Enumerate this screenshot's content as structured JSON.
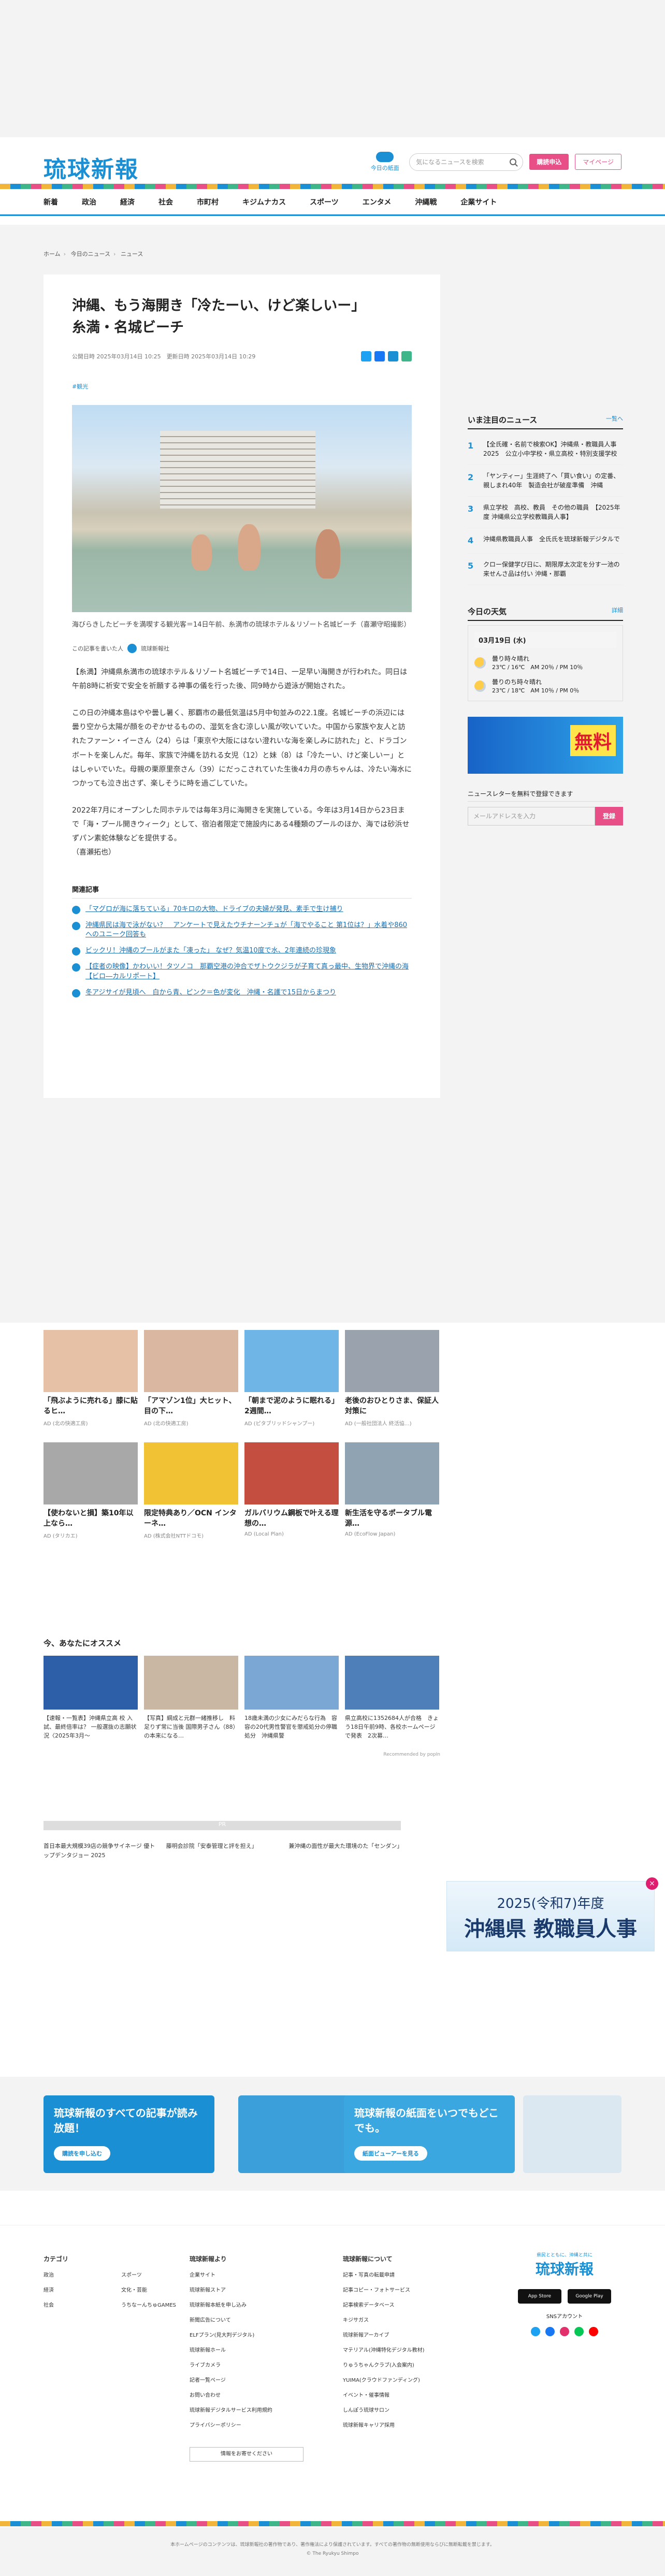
{
  "header": {
    "logo": "琉球新報",
    "today_label": "今日の紙面",
    "search_placeholder": "気になるニュースを検索",
    "subscribe": "購読申込",
    "mypage": "マイページ"
  },
  "nav": [
    "新着",
    "政治",
    "経済",
    "社会",
    "市町村",
    "キジムナカス",
    "スポーツ",
    "エンタメ",
    "沖縄戦",
    "企業サイト"
  ],
  "breadcrumb": [
    "ホーム",
    "今日のニュース",
    "ニュース"
  ],
  "article": {
    "title": "沖縄、もう海開き「冷たーい、けど楽しいー」 糸満・名城ビーチ",
    "published": "公開日時 2025年03月14日 10:25",
    "updated": "更新日時 2025年03月14日 10:29",
    "tag": "#観光",
    "caption": "海びらきしたビーチを満喫する観光客＝14日午前、糸満市の琉球ホテル＆リゾート名城ビーチ（喜瀬守昭撮影）",
    "writer_prefix": "この記事を書いた人",
    "writer": "琉球新報社",
    "paragraphs": [
      "【糸満】沖縄県糸満市の琉球ホテル＆リゾート名城ビーチで14日、一足早い海開きが行われた。同日は午前8時に祈安で安全を祈願する神事の儀を行った後、同9時から遊泳が開始された。",
      "この日の沖縄本島はやや曇し暑く、那覇市の最低気温は5月中旬並みの22.1度。名城ビーチの浜辺には曇り空から太陽が顔をのぞかせるものの、湿気を含む涼しい風が吹いていた。中国から家族や友人と訪れたファーン・イーさん（24）らは「東京や大阪にはない澄れいな海を楽しみに訪れた」と、ドラゴンボートを楽しんだ。毎年、家族で沖縄を訪れる女児（12）と妹（8）は「冷たーい、けど楽しいー」とはしゃいでいた。母親の栗原里奈さん（39）にだっこされていた生後4カ月の赤ちゃんは、冷たい海水につかっても泣き出さず、楽しそうに時を過ごしていた。",
      "2022年7月にオープンした同ホテルでは毎年3月に海開きを実施している。今年は3月14日から23日まで「海・プール開きウィーク」として、宿泊者限定で施設内にある4種類のプールのほか、海では砂浜せずパン素蛇体験などを提供する。",
      "（喜瀬拓也）"
    ],
    "related_heading": "関連記事",
    "related": [
      "「マグロが海に落ちている」70キロの大物、ドライブの夫婦が発見、素手で生け捕り",
      "沖縄県民は海で泳がない？　アンケートで見えたウチナーンチュが「海でやること 第1位は？」水着や860へのユニーク回答も",
      "ビックリ！沖縄のプールがまた「凍った」 なぜ？気温10度で水、2年連続の珍現象",
      "【症者の映像】かわいい！タツノコ　那覇空港の沖合でザトウクジラが子育て真っ最中、生物界で沖縄の海【ビロ―カルリポート】",
      "冬アジサイが見頃へ　白から青、ピンク＝色が変化　沖縄・名護で15日からまつり"
    ]
  },
  "sidebar": {
    "ranking_title": "いま注目のニュース",
    "ranking_more": "一覧へ",
    "ranking": [
      "【全氏確・名前で検索OK】沖縄県・教職員人事2025　公立小中学校・県立高校・特別支援学校",
      "「ヤンティー」生涯終了へ「買い食い」の定番、親しまれ40年　製造会社が破産準備　沖縄",
      "県立学校　高校、教員　その他の職員　【2025年度 沖縄県公立学校教職員人事】",
      "沖縄県教職員人事　全氏氏を琉球新報デジタルで",
      "クロー保健学び日に、期限厚太次定を分す一池の来せんさ品は付い 沖縄・那覇"
    ],
    "weather_title": "今日の天気",
    "weather_more": "詳細",
    "weather_date": "03月19日 (水)",
    "weather_rows": [
      {
        "label": "曇り時々晴れ",
        "detail": "23℃ / 16℃　AM 20％ / PM 10％"
      },
      {
        "label": "曇りのち時々晴れ",
        "detail": "23℃ / 18℃　AM 10％ / PM 0％"
      }
    ],
    "ad_text": "無料",
    "newsletter_title": "ニュースレターを無料で登録できます",
    "newsletter_placeholder": "メールアドレスを入力",
    "newsletter_button": "登録"
  },
  "ads": [
    {
      "title": "「飛ぶように売れる」膝に貼るヒ…",
      "src": "AD (北の快適工房)"
    },
    {
      "title": "「アマゾン1位」大ヒット、目の下…",
      "src": "AD (北の快適工房)"
    },
    {
      "title": "「朝まで泥のように眠れる」2週間…",
      "src": "AD (ピタブリッドシャンプー)"
    },
    {
      "title": "老後のおひとりさま、保証人対策に",
      "src": "AD (一般社団法人 終活協…)"
    },
    {
      "title": "【使わないと損】築10年以上なら…",
      "src": "AD (タリカエ)"
    },
    {
      "title": "限定特典あり／OCN インターネ…",
      "src": "AD (株式会社NTTドコモ)"
    },
    {
      "title": "ガルバリウム鋼板で叶える理想の…",
      "src": "AD (Local Plan)"
    },
    {
      "title": "新生活を守るポータブル電源…",
      "src": "AD (EcoFlow Japan)"
    }
  ],
  "reco": {
    "title": "今、あなたにオススメ",
    "items": [
      "【速報・一覧表】沖縄県立高 校 入試、最終倍率は？ 一般選抜の志願状況〈2025年3月〜",
      "【写真】綱成と元群一緒推移し　料足りず常に当後 国際男子さん（88）の本来になる…",
      "18歳未満の少女にみだらな行為　容容の20代男性警官を懲戒処分の停職処分　沖縄県警",
      "県立高校に1352684人が合格　きょう18日午前9時、各校ホームページで発表　2次募…"
    ],
    "powered": "Recommended by popIn"
  },
  "ticker": {
    "label": "PR",
    "items": [
      "首日本最大規模39店の競争サイネージ 優トップデンタジョー 2025",
      "藤明会診院「安泰管理と評を担え」",
      "兼沖縄の面性が最大た環境のた「センダン」"
    ]
  },
  "banner": {
    "year": "2025(令和7)年度",
    "main": "沖縄県 教職員人事"
  },
  "promo": {
    "card1_heading": "琉球新報のすべての記事が読み放題！",
    "card1_button": "購読を申し込む",
    "card2_heading": "琉球新報の紙面をいつでもどこでも。",
    "card2_button": "紙面ビューアーを見る"
  },
  "footer": {
    "col1_title": "カテゴリ",
    "col1": [
      "政治",
      "経済",
      "社会",
      "スポーツ",
      "文化・芸能",
      "うちなーんちゅGAMES"
    ],
    "col2_title": "琉球新報より",
    "col2": [
      "企業サイト",
      "琉球新報ストア",
      "琉球新報本紙を申し込み",
      "新聞広告について",
      "ELFプラン(見大判デジタル)",
      "琉球新報ホール",
      "ライブカメラ",
      "記者一覧ページ",
      "お問い合わせ",
      "琉球新報デジタルサービス利用規約",
      "プライバシーポリシー"
    ],
    "col3_title": "琉球新報について",
    "col3": [
      "記事・写真の転載申請",
      "記事コピー・フォトサービス",
      "記事検索データベース",
      "キジサガス",
      "琉球新報アーカイブ",
      "マテリアル(沖縄特化デジタル教材)",
      "りゅうちゃんクラブ(入会案内)",
      "YUIMA(クラウドファンディング)",
      "イベント・催事情報",
      "しんぽう琉球サロン",
      "琉球新報キャリア採用"
    ],
    "help": "情報をお寄せください",
    "logo_sub": "県民とともに、沖縄と共に",
    "logo": "琉球新報",
    "store1": "App Store",
    "store2": "Google Play",
    "sns": "SNSアカウント",
    "copyright1": "本ホームページのコンテンツは、琉球新報社の著作物であり、著作権法により保護されています。すべての著作物の無断使用ならびに無断転載を禁じます。",
    "copyright2": "© The Ryukyu Shimpo"
  }
}
